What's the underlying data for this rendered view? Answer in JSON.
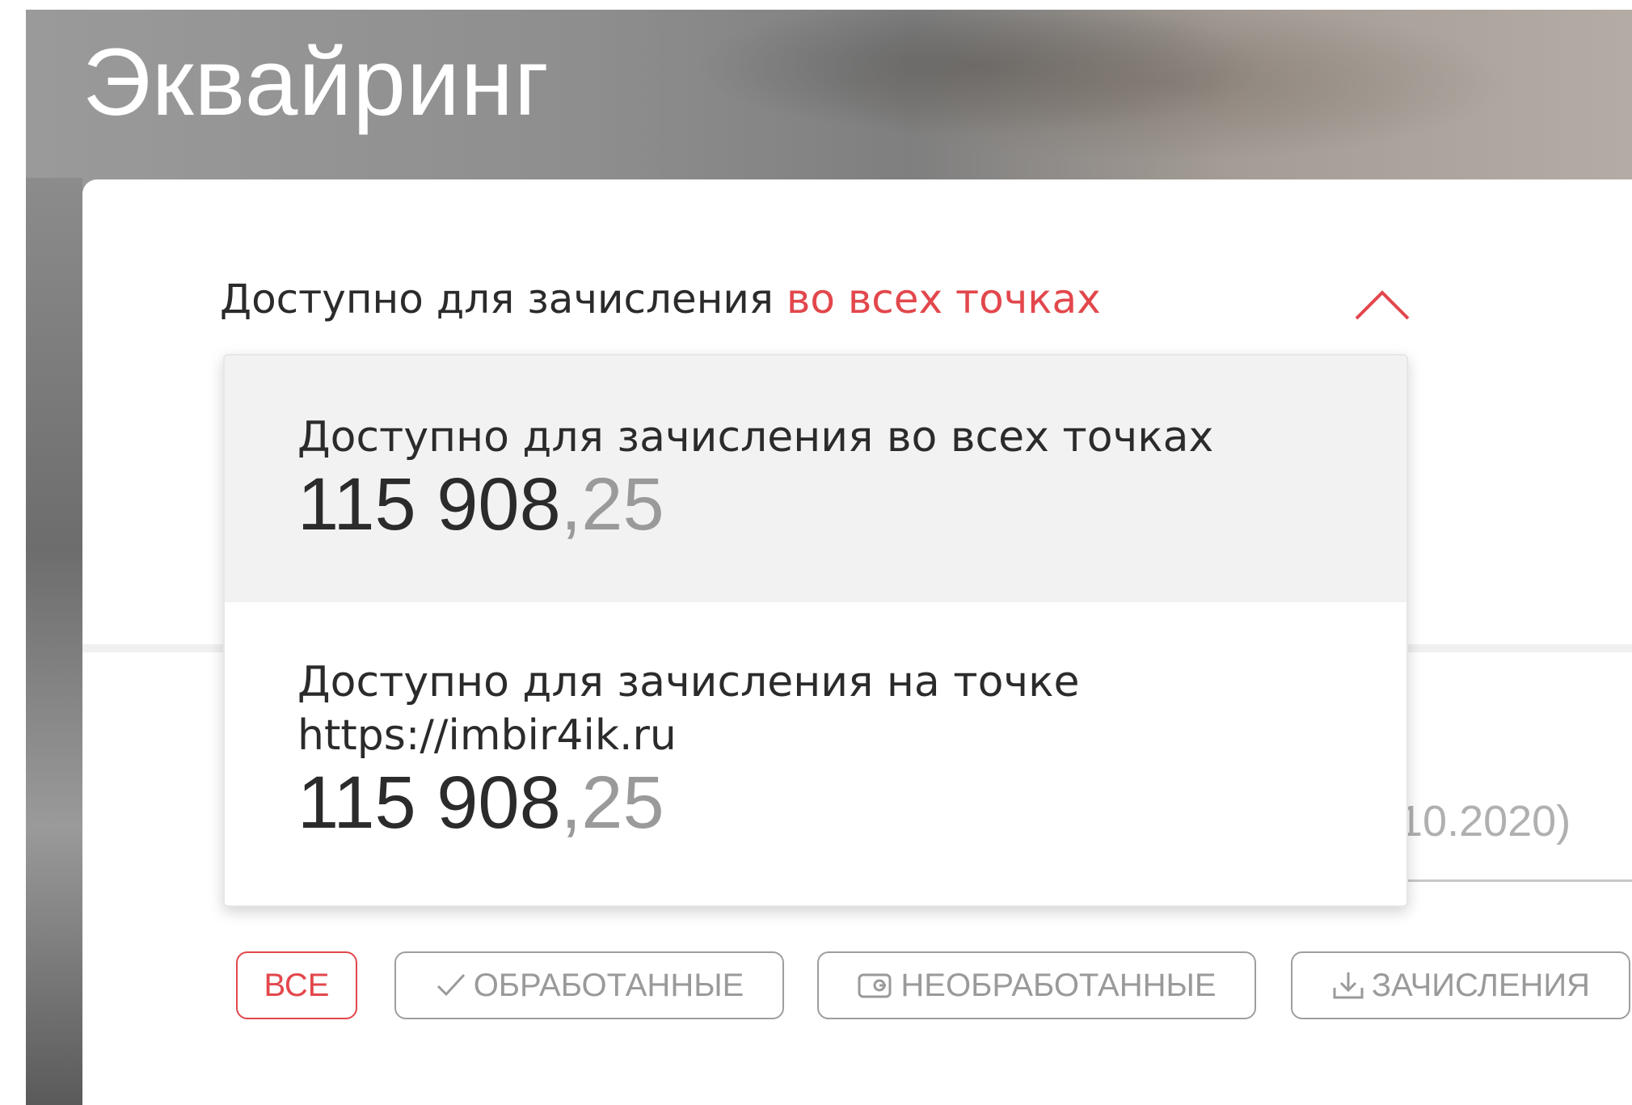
{
  "page": {
    "title": "Эквайринг"
  },
  "selector": {
    "label": "Доступно для зачисления",
    "accent": "во всех точках",
    "accent_color": "#e2474c",
    "chevron_icon": "chevron-up-icon"
  },
  "dropdown": {
    "options": [
      {
        "label": "Доступно для зачисления во всех точках",
        "amount_whole": "115 908",
        "amount_cents": ",25",
        "selected": true
      },
      {
        "label": "Доступно для зачисления на точке",
        "url": "https://imbir4ik.ru",
        "amount_whole": "115 908",
        "amount_cents": ",25",
        "selected": false
      }
    ]
  },
  "period": {
    "text": ".10.2020)"
  },
  "filters": [
    {
      "label": "ВСЕ",
      "active": true,
      "icon": ""
    },
    {
      "label": "ОБРАБОТАННЫЕ",
      "active": false,
      "icon": "check-icon"
    },
    {
      "label": "НЕОБРАБОТАННЫЕ",
      "active": false,
      "icon": "wallet-icon"
    },
    {
      "label": "ЗАЧИСЛЕНИЯ",
      "active": false,
      "icon": "download-icon"
    }
  ]
}
